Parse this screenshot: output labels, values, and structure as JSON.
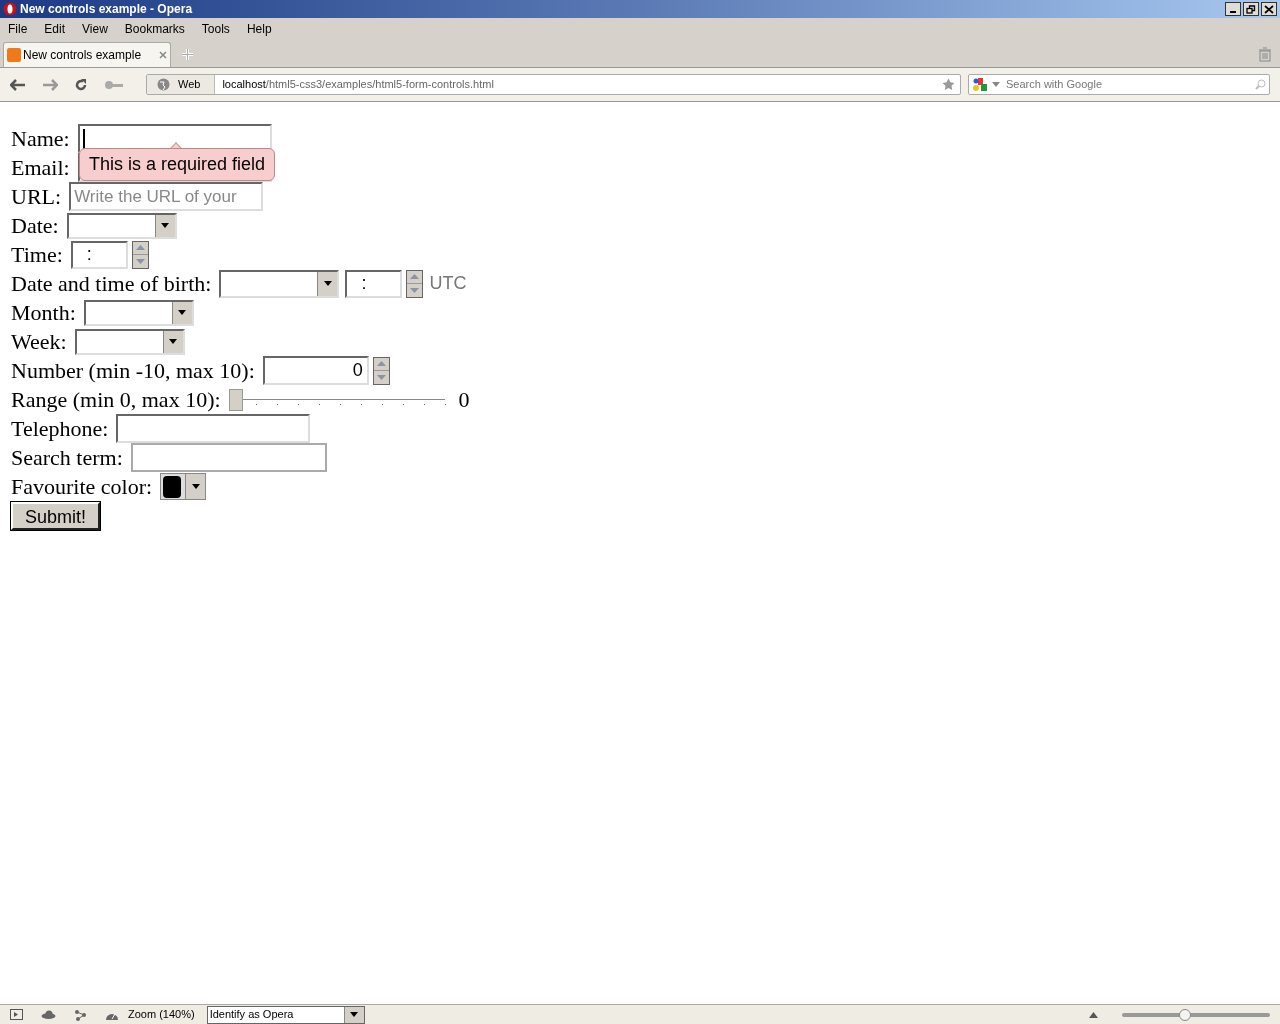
{
  "window": {
    "title": "New controls example - Opera"
  },
  "menu": [
    "File",
    "Edit",
    "View",
    "Bookmarks",
    "Tools",
    "Help"
  ],
  "tabs": [
    {
      "label": "New controls example",
      "selected": true
    }
  ],
  "address_bar": {
    "web_label": "Web",
    "host": "localhost",
    "path": "/html5-css3/examples/html5-form-controls.html"
  },
  "search": {
    "placeholder": "Search with Google"
  },
  "form": {
    "fields": [
      {
        "kind": "text",
        "label": "Name:",
        "focused": true
      },
      {
        "kind": "text",
        "label": "Email:"
      },
      {
        "kind": "text",
        "label": "URL:",
        "placeholder": "Write the URL of your"
      },
      {
        "kind": "select",
        "label": "Date:"
      },
      {
        "kind": "time",
        "label": "Time:",
        "value": ":"
      },
      {
        "kind": "datetime",
        "label": "Date and time of birth:",
        "value": ":",
        "suffix": "UTC"
      },
      {
        "kind": "select",
        "label": "Month:"
      },
      {
        "kind": "select",
        "label": "Week:"
      },
      {
        "kind": "number",
        "label": "Number (min -10, max 10):",
        "value": "0"
      },
      {
        "kind": "range",
        "label": "Range (min 0, max 10):",
        "level": 0,
        "reading": "0"
      },
      {
        "kind": "text",
        "label": "Telephone:"
      },
      {
        "kind": "search",
        "label": "Search term:"
      },
      {
        "kind": "color",
        "label": "Favourite color:",
        "color": "#000000"
      },
      {
        "kind": "submit",
        "label": "Submit!"
      }
    ],
    "tooltip": "This is a required field"
  },
  "status_bar": {
    "zoom": "Zoom (140%)",
    "identify": "Identify as Opera",
    "zoom_slider": {
      "level": 0.42
    }
  }
}
